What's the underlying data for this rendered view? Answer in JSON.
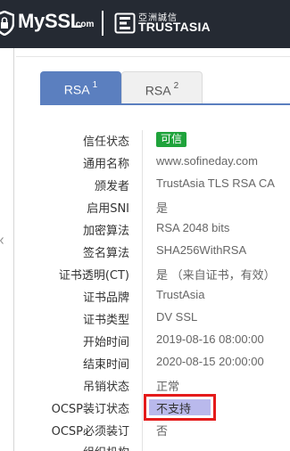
{
  "header": {
    "brand": "MySSL",
    "brand_suffix": ".com",
    "partner_cn": "亞洲誠信",
    "partner_en": "TRUSTASIA"
  },
  "tabs": [
    {
      "label": "RSA",
      "index": "1",
      "active": true
    },
    {
      "label": "RSA",
      "index": "2",
      "active": false
    }
  ],
  "colors": {
    "header_bg": "#252a33",
    "tab_active": "#5b7fbf",
    "badge_green": "#1fa33b",
    "highlight_border": "#e41b1b",
    "highlight_fill": "#b9b9ec"
  },
  "rows": [
    {
      "label": "信任状态",
      "value": "可信"
    },
    {
      "label": "通用名称",
      "value": "www.sofineday.com"
    },
    {
      "label": "颁发者",
      "value": "TrustAsia TLS RSA CA"
    },
    {
      "label": "启用SNI",
      "value": "是"
    },
    {
      "label": "加密算法",
      "value": "RSA 2048 bits"
    },
    {
      "label": "签名算法",
      "value": "SHA256WithRSA"
    },
    {
      "label": "证书透明(CT)",
      "value": "是 （来自证书，有效）"
    },
    {
      "label": "证书品牌",
      "value": "TrustAsia"
    },
    {
      "label": "证书类型",
      "value": "DV SSL"
    },
    {
      "label": "开始时间",
      "value": "2019-08-16 08:00:00"
    },
    {
      "label": "结束时间",
      "value": "2020-08-15 20:00:00"
    },
    {
      "label": "吊销状态",
      "value": "正常"
    },
    {
      "label": "OCSP装订状态",
      "value": "不支持"
    },
    {
      "label": "OCSP必须装订",
      "value": "否"
    },
    {
      "label": "组织机构",
      "value": ""
    }
  ]
}
